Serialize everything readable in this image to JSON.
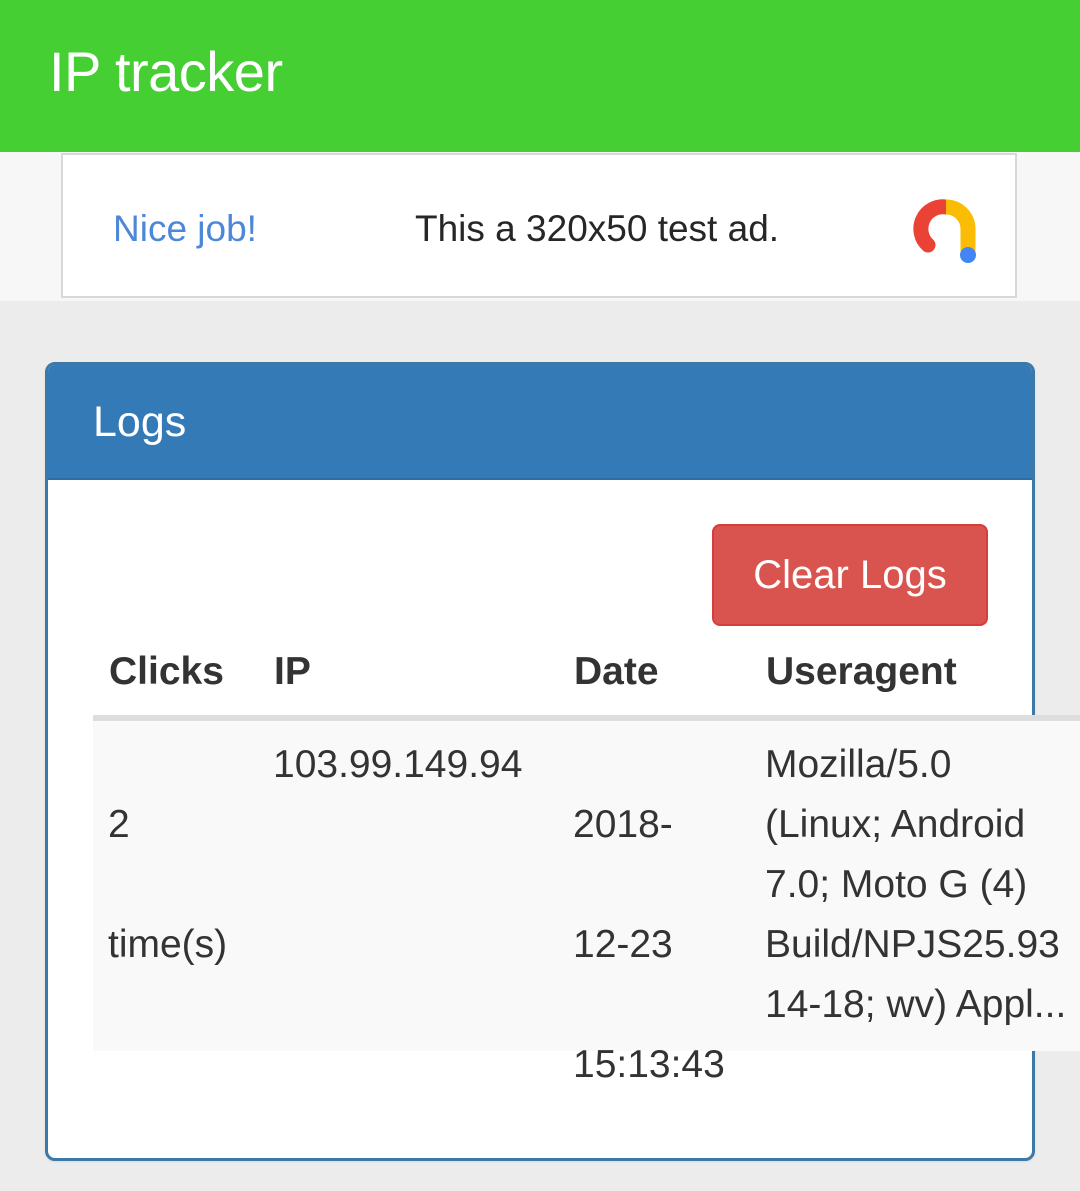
{
  "app_bar": {
    "title": "IP tracker",
    "color": "#45cf33"
  },
  "ad": {
    "cta": "Nice job!",
    "text": "This a 320x50 test ad.",
    "logo_icon": "google-ads-logo-icon",
    "cta_color": "#4d87d8"
  },
  "logs_panel": {
    "title": "Logs",
    "header_color": "#337ab7",
    "clear_button_label": "Clear Logs",
    "clear_button_color": "#d9534f",
    "table": {
      "columns": [
        "Clicks",
        "IP",
        "Date",
        "Useragent"
      ],
      "rows": [
        {
          "clicks_lines": [
            "2",
            "time(s)"
          ],
          "ip": "103.99.149.94",
          "date_lines": [
            "2018-",
            "12-23",
            "15:13:43"
          ],
          "useragent_lines": [
            "Mozilla/5.0",
            "(Linux; Android",
            "7.0; Moto G (4)",
            "Build/NPJS25.93",
            "14-18; wv) Appl..."
          ]
        }
      ]
    }
  }
}
